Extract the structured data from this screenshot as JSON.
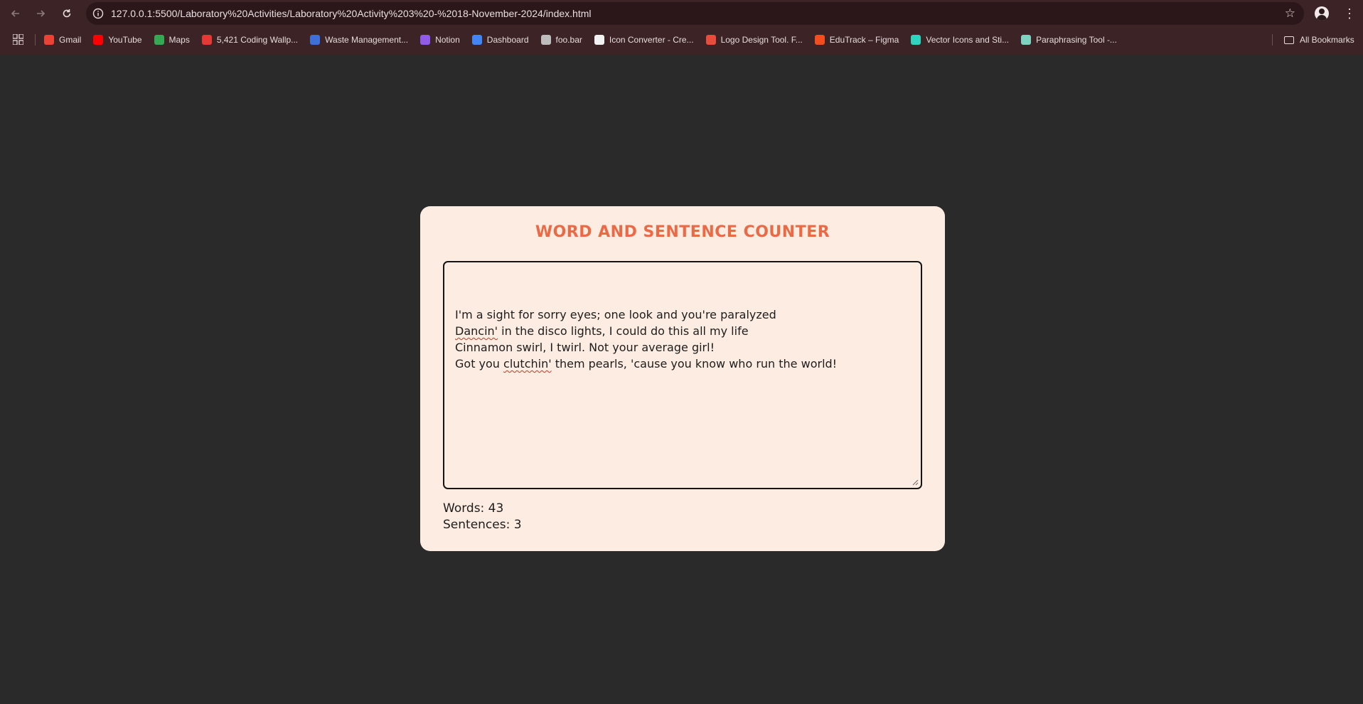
{
  "browser": {
    "url": "127.0.0.1:5500/Laboratory%20Activities/Laboratory%20Activity%203%20-%2018-November-2024/index.html",
    "icons": {
      "back": "arrow-left-icon",
      "forward": "arrow-right-icon",
      "reload": "reload-icon",
      "site_info": "info-icon",
      "bookmark_star": "star-icon",
      "menu": "kebab-menu-icon"
    },
    "bookmarks": [
      {
        "label": "Gmail",
        "icon": "gmail-icon",
        "color": "#ea4335"
      },
      {
        "label": "YouTube",
        "icon": "youtube-icon",
        "color": "#ff0000"
      },
      {
        "label": "Maps",
        "icon": "maps-icon",
        "color": "#34a853"
      },
      {
        "label": "5,421 Coding Wallp...",
        "icon": "wallpaper-icon",
        "color": "#e53935"
      },
      {
        "label": "Waste Management...",
        "icon": "waste-icon",
        "color": "#3f6fd8"
      },
      {
        "label": "Notion",
        "icon": "notion-icon",
        "color": "#8f5be8"
      },
      {
        "label": "Dashboard",
        "icon": "dashboard-icon",
        "color": "#4285f4"
      },
      {
        "label": "foo.bar",
        "icon": "globe-icon",
        "color": "#bdbdbd"
      },
      {
        "label": "Icon Converter - Cre...",
        "icon": "converter-icon",
        "color": "#f2f2f2"
      },
      {
        "label": "Logo Design Tool. F...",
        "icon": "logo-tool-icon",
        "color": "#e84c3d"
      },
      {
        "label": "EduTrack – Figma",
        "icon": "figma-icon",
        "color": "#f24e1e"
      },
      {
        "label": "Vector Icons and Sti...",
        "icon": "vector-icon",
        "color": "#2dd4bf"
      },
      {
        "label": "Paraphrasing Tool -...",
        "icon": "paraphrase-icon",
        "color": "#7dd3c0"
      }
    ],
    "all_bookmarks": "All Bookmarks"
  },
  "page": {
    "title": "WORD AND SENTENCE COUNTER",
    "text_lines": [
      {
        "before": "I'm a sight for sorry eyes; one look and you're paralyzed",
        "flag": "",
        "after": ""
      },
      {
        "before": "",
        "flag": "Dancin'",
        "after": " in the disco lights, I could do this all my life"
      },
      {
        "before": "Cinnamon swirl, I twirl. Not your average girl!",
        "flag": "",
        "after": ""
      },
      {
        "before": "Got you ",
        "flag": "clutchin'",
        "after": " them pearls, 'cause you know who run the world!"
      }
    ],
    "words_label": "Words: 43",
    "sentences_label": "Sentences: 3"
  },
  "colors": {
    "page_background": "#2a2a2a",
    "card": "#fdece1",
    "title": "#ea6a46",
    "text": "#1d1d1d",
    "chrome": "#3b2326"
  }
}
